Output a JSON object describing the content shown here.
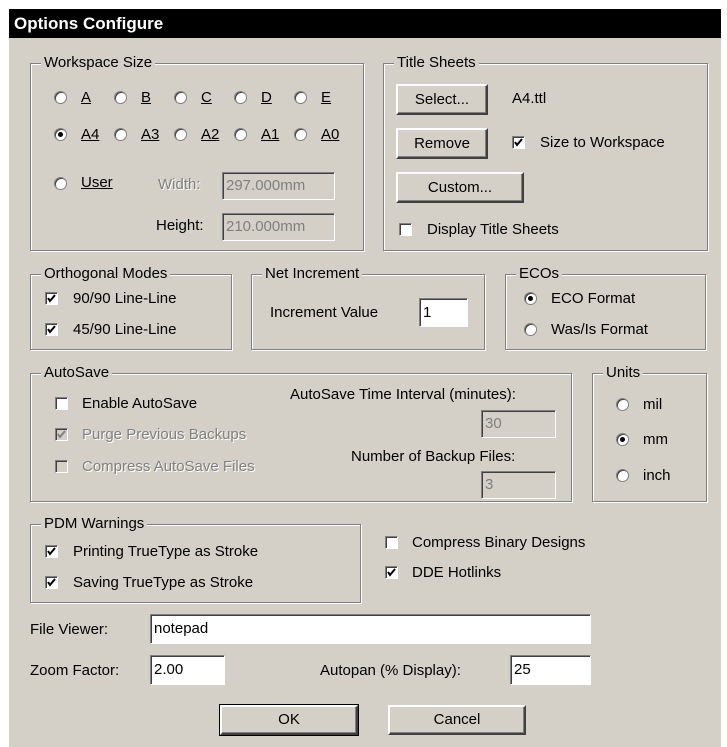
{
  "window": {
    "title": "Options Configure"
  },
  "workspace_size": {
    "legend": "Workspace Size",
    "sizes_row1": [
      "A",
      "B",
      "C",
      "D",
      "E"
    ],
    "sizes_row2": [
      "A4",
      "A3",
      "A2",
      "A1",
      "A0"
    ],
    "selected": "A4",
    "user_label": "User",
    "width_label": "Width:",
    "width_value": "297.000mm",
    "height_label": "Height:",
    "height_value": "210.000mm"
  },
  "title_sheets": {
    "legend": "Title Sheets",
    "select_button": "Select...",
    "current_file": "A4.ttl",
    "remove_button": "Remove",
    "size_to_workspace_label": "Size to Workspace",
    "size_to_workspace_checked": true,
    "custom_button": "Custom...",
    "display_title_sheets_label": "Display Title Sheets",
    "display_title_sheets_checked": false
  },
  "orthogonal_modes": {
    "legend": "Orthogonal Modes",
    "items": [
      {
        "label": "90/90  Line-Line",
        "checked": true
      },
      {
        "label": "45/90  Line-Line",
        "checked": true
      }
    ]
  },
  "net_increment": {
    "legend": "Net Increment",
    "label": "Increment Value",
    "value": "1"
  },
  "ecos": {
    "legend": "ECOs",
    "options": [
      "ECO Format",
      "Was/Is Format"
    ],
    "selected": "ECO Format"
  },
  "autosave": {
    "legend": "AutoSave",
    "enable_label": "Enable AutoSave",
    "enable_checked": false,
    "purge_label": "Purge Previous Backups",
    "purge_checked": true,
    "compress_label": "Compress AutoSave Files",
    "compress_checked": false,
    "interval_label": "AutoSave Time Interval (minutes):",
    "interval_value": "30",
    "backup_files_label": "Number of Backup Files:",
    "backup_files_value": "3"
  },
  "units": {
    "legend": "Units",
    "options": [
      "mil",
      "mm",
      "inch"
    ],
    "selected": "mm"
  },
  "pdm_warnings": {
    "legend": "PDM Warnings",
    "items": [
      {
        "label": "Printing TrueType as Stroke",
        "checked": true
      },
      {
        "label": "Saving TrueType as Stroke",
        "checked": true
      }
    ]
  },
  "misc": {
    "compress_binary_label": "Compress Binary Designs",
    "compress_binary_checked": false,
    "dde_hotlinks_label": "DDE Hotlinks",
    "dde_hotlinks_checked": true
  },
  "file_viewer": {
    "label": "File Viewer:",
    "value": "notepad"
  },
  "zoom_factor": {
    "label": "Zoom Factor:",
    "value": "2.00"
  },
  "autopan": {
    "label": "Autopan (% Display):",
    "value": "25"
  },
  "buttons": {
    "ok": "OK",
    "cancel": "Cancel"
  }
}
